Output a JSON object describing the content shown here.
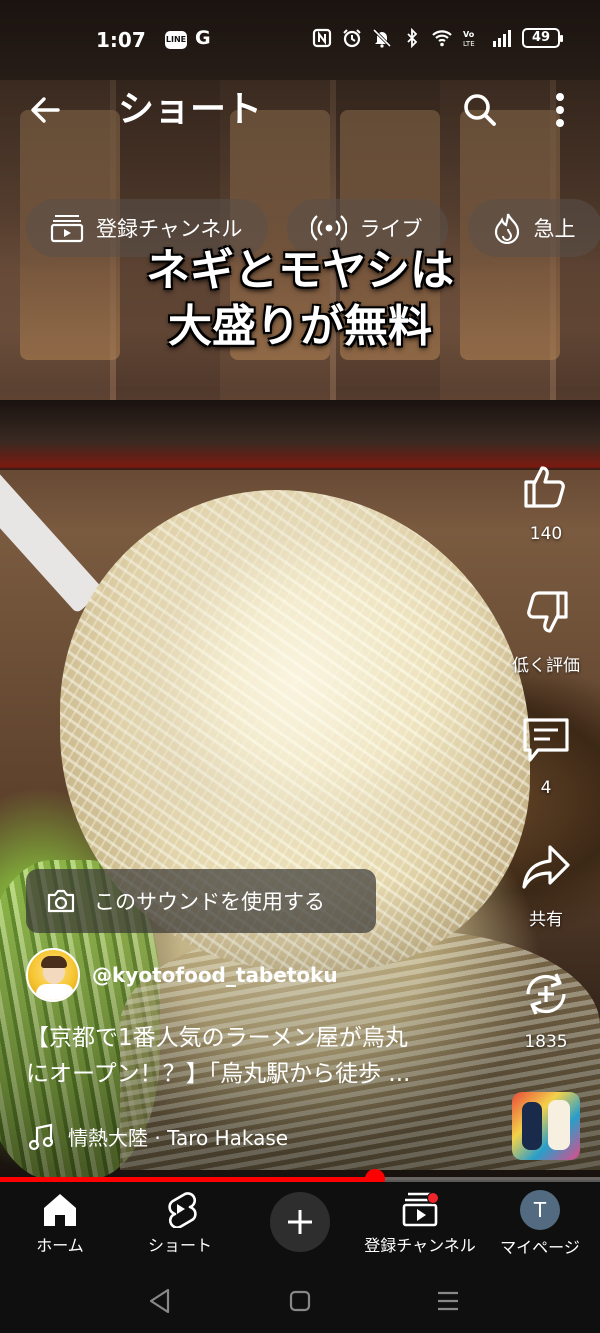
{
  "status_bar": {
    "time": "1:07",
    "app_icons": [
      "LINE",
      "G"
    ],
    "battery": "49",
    "icons": [
      "nfc-icon",
      "alarm-icon",
      "mute-icon",
      "bluetooth-icon",
      "wifi-icon",
      "volte-icon",
      "signal-icon",
      "battery-icon"
    ]
  },
  "header": {
    "title": "ショート",
    "icons": [
      "back-arrow-icon",
      "search-icon",
      "more-vert-icon"
    ]
  },
  "chips": [
    {
      "label": "登録チャンネル",
      "icon": "subscriptions-icon"
    },
    {
      "label": "ライブ",
      "icon": "live-broadcast-icon"
    },
    {
      "label": "急上",
      "icon": "trending-icon"
    }
  ],
  "video": {
    "caption_line1": "ネギとモヤシは",
    "caption_line2": "大盛りが無料"
  },
  "actions": {
    "like_count": "140",
    "dislike_label": "低く評価",
    "comment_count": "4",
    "share_label": "共有",
    "remix_count": "1835"
  },
  "sound": {
    "use_sound_label": "このサウンドを使用する"
  },
  "channel": {
    "handle": "@kyotofood_tabetoku"
  },
  "title": {
    "line1": "【京都で1番人気のラーメン屋が烏丸",
    "line2": "にオープン！？】「烏丸駅から徒歩 ..."
  },
  "music": {
    "track": "情熱大陸 · Taro Hakase"
  },
  "playback": {
    "progress_percent": 62.5
  },
  "bottom_nav": {
    "home": "ホーム",
    "shorts": "ショート",
    "subscriptions": "登録チャンネル",
    "mypage": "マイページ",
    "avatar_letter": "T"
  },
  "colors": {
    "accent": "#ff0000",
    "nav_bg": "#0f0f0f",
    "notification": "#f0252b"
  }
}
